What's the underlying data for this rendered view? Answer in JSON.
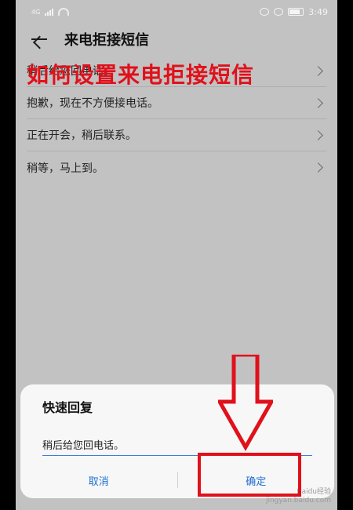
{
  "status_bar": {
    "left_signal_text": "4G",
    "time": "3:49",
    "battery_text": ""
  },
  "header": {
    "title": "来电拒接短信"
  },
  "overlay_caption": "如何设置来电拒接短信",
  "messages": [
    {
      "label": "稍后给您回电话。"
    },
    {
      "label": "抱歉，现在不方便接电话。"
    },
    {
      "label": "正在开会，稍后联系。"
    },
    {
      "label": "稍等，马上到。"
    }
  ],
  "dialog": {
    "title": "快速回复",
    "input_value": "稍后给您回电话。",
    "cancel_label": "取消",
    "confirm_label": "确定"
  },
  "watermark": {
    "line1": "Baidu经验",
    "line2": "jingyan.baidu.com"
  },
  "colors": {
    "annotation_red": "#e0111b",
    "action_blue": "#1f6fd1",
    "screen_gray": "#c2c2c2"
  }
}
